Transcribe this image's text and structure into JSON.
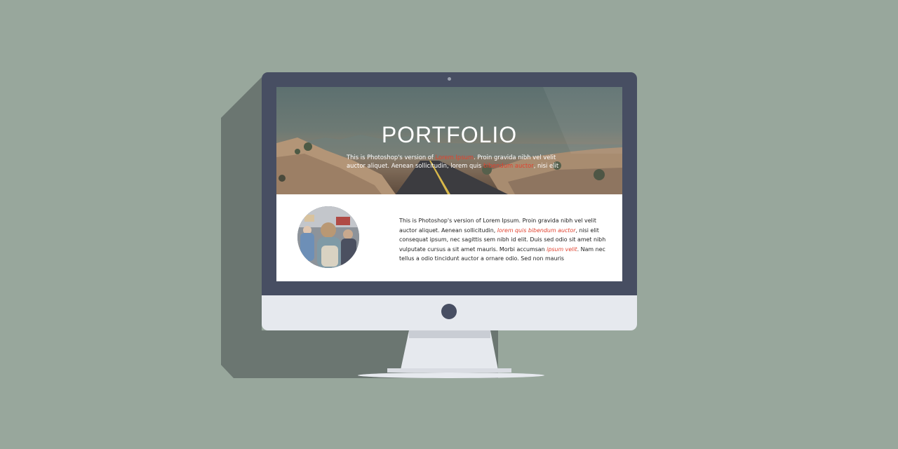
{
  "colors": {
    "background": "#98a79c",
    "bezel": "#474e62",
    "chin": "#e6e9ee",
    "accent": "#e0422f"
  },
  "hero": {
    "title": "PORTFOLIO",
    "text_1": "This is Photoshop's version  of ",
    "highlight_1": "Lorem Ipsum",
    "text_2": ". Proin gravida nibh vel velit auctor aliquet. Aenean sollicitudin, lorem quis ",
    "highlight_2": "bibendum auctor",
    "text_3": ", nisi elit"
  },
  "content": {
    "avatar_icon": "person-with-backpack-photo",
    "text_1": "This is Photoshop's version  of Lorem Ipsum. Proin gravida nibh vel velit auctor aliquet. Aenean sollicitudin, ",
    "highlight_1": "lorem quis bibendum auctor",
    "text_2": ", nisi elit consequat ipsum, nec sagittis sem nibh id elit. Duis sed odio sit amet nibh vulputate cursus a sit amet mauris. Morbi accumsan ",
    "highlight_2": "ipsum velit",
    "text_3": ". Nam nec tellus a odio tincidunt auctor a ornare odio. Sed non  mauris"
  }
}
